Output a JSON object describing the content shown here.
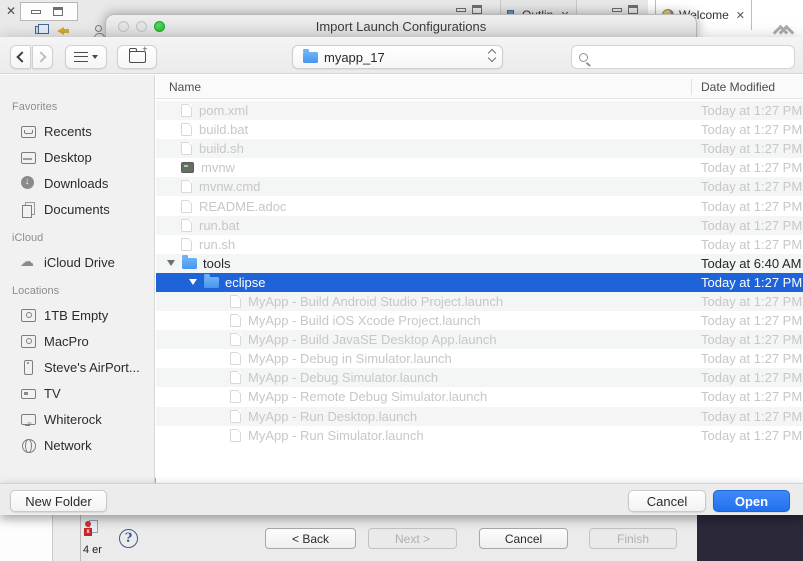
{
  "background": {
    "tabs": {
      "outline_label": "Outlin",
      "welcome_label": "Welcome",
      "outline_close": "✕",
      "welcome_close": "✕",
      "editor_close": "✕"
    },
    "status": {
      "error_text": "4 er"
    },
    "wizard": {
      "help_label": "?",
      "back_label": "< Back",
      "next_label": "Next >",
      "cancel_label": "Cancel",
      "finish_label": "Finish"
    }
  },
  "dialog": {
    "title": "Import Launch Configurations",
    "toolbar": {
      "location_value": "myapp_17",
      "search_placeholder": ""
    },
    "sidebar": {
      "sections": [
        {
          "label": "Favorites",
          "items": [
            {
              "icon": "recents-icon",
              "label": "Recents"
            },
            {
              "icon": "desktop-icon",
              "label": "Desktop"
            },
            {
              "icon": "downloads-icon",
              "label": "Downloads"
            },
            {
              "icon": "documents-icon",
              "label": "Documents"
            }
          ]
        },
        {
          "label": "iCloud",
          "items": [
            {
              "icon": "cloud-icon",
              "label": "iCloud Drive"
            }
          ]
        },
        {
          "label": "Locations",
          "items": [
            {
              "icon": "drive-icon",
              "label": "1TB Empty"
            },
            {
              "icon": "drive-icon",
              "label": "MacPro"
            },
            {
              "icon": "airport-icon",
              "label": "Steve's AirPort..."
            },
            {
              "icon": "tv-icon",
              "label": "TV"
            },
            {
              "icon": "display-icon",
              "label": "Whiterock"
            },
            {
              "icon": "network-icon",
              "label": "Network"
            }
          ]
        }
      ]
    },
    "list": {
      "columns": [
        "Name",
        "Date Modified"
      ],
      "rows": [
        {
          "name": "pom.xml",
          "date": "Today at 1:27 PM",
          "kind": "doc",
          "depth": 0,
          "state": "disabled"
        },
        {
          "name": "build.bat",
          "date": "Today at 1:27 PM",
          "kind": "doc",
          "depth": 0,
          "state": "disabled"
        },
        {
          "name": "build.sh",
          "date": "Today at 1:27 PM",
          "kind": "doc",
          "depth": 0,
          "state": "disabled"
        },
        {
          "name": "mvnw",
          "date": "Today at 1:27 PM",
          "kind": "exec",
          "depth": 0,
          "state": "disabled"
        },
        {
          "name": "mvnw.cmd",
          "date": "Today at 1:27 PM",
          "kind": "doc",
          "depth": 0,
          "state": "disabled"
        },
        {
          "name": "README.adoc",
          "date": "Today at 1:27 PM",
          "kind": "doc",
          "depth": 0,
          "state": "disabled"
        },
        {
          "name": "run.bat",
          "date": "Today at 1:27 PM",
          "kind": "doc",
          "depth": 0,
          "state": "disabled"
        },
        {
          "name": "run.sh",
          "date": "Today at 1:27 PM",
          "kind": "doc",
          "depth": 0,
          "state": "disabled"
        },
        {
          "name": "tools",
          "date": "Today at 6:40 AM",
          "kind": "folder",
          "depth": 0,
          "state": "normal",
          "expanded": true
        },
        {
          "name": "eclipse",
          "date": "Today at 1:27 PM",
          "kind": "folder",
          "depth": 1,
          "state": "selected",
          "expanded": true
        },
        {
          "name": "MyApp - Build Android Studio Project.launch",
          "date": "Today at 1:27 PM",
          "kind": "doc",
          "depth": 2,
          "state": "disabled"
        },
        {
          "name": "MyApp - Build iOS Xcode Project.launch",
          "date": "Today at 1:27 PM",
          "kind": "doc",
          "depth": 2,
          "state": "disabled"
        },
        {
          "name": "MyApp - Build JavaSE Desktop App.launch",
          "date": "Today at 1:27 PM",
          "kind": "doc",
          "depth": 2,
          "state": "disabled"
        },
        {
          "name": "MyApp - Debug in Simulator.launch",
          "date": "Today at 1:27 PM",
          "kind": "doc",
          "depth": 2,
          "state": "disabled"
        },
        {
          "name": "MyApp - Debug Simulator.launch",
          "date": "Today at 1:27 PM",
          "kind": "doc",
          "depth": 2,
          "state": "disabled"
        },
        {
          "name": "MyApp - Remote Debug Simulator.launch",
          "date": "Today at 1:27 PM",
          "kind": "doc",
          "depth": 2,
          "state": "disabled"
        },
        {
          "name": "MyApp - Run Desktop.launch",
          "date": "Today at 1:27 PM",
          "kind": "doc",
          "depth": 2,
          "state": "disabled"
        },
        {
          "name": "MyApp - Run Simulator.launch",
          "date": "Today at 1:27 PM",
          "kind": "doc",
          "depth": 2,
          "state": "disabled"
        }
      ]
    },
    "footer": {
      "new_folder_label": "New Folder",
      "cancel_label": "Cancel",
      "open_label": "Open"
    }
  },
  "colors": {
    "selection_blue": "#1e63d8",
    "open_button_blue": "#2e7cf4",
    "traffic_green": "#2fc33a",
    "dark_panel": "#2b2839"
  }
}
